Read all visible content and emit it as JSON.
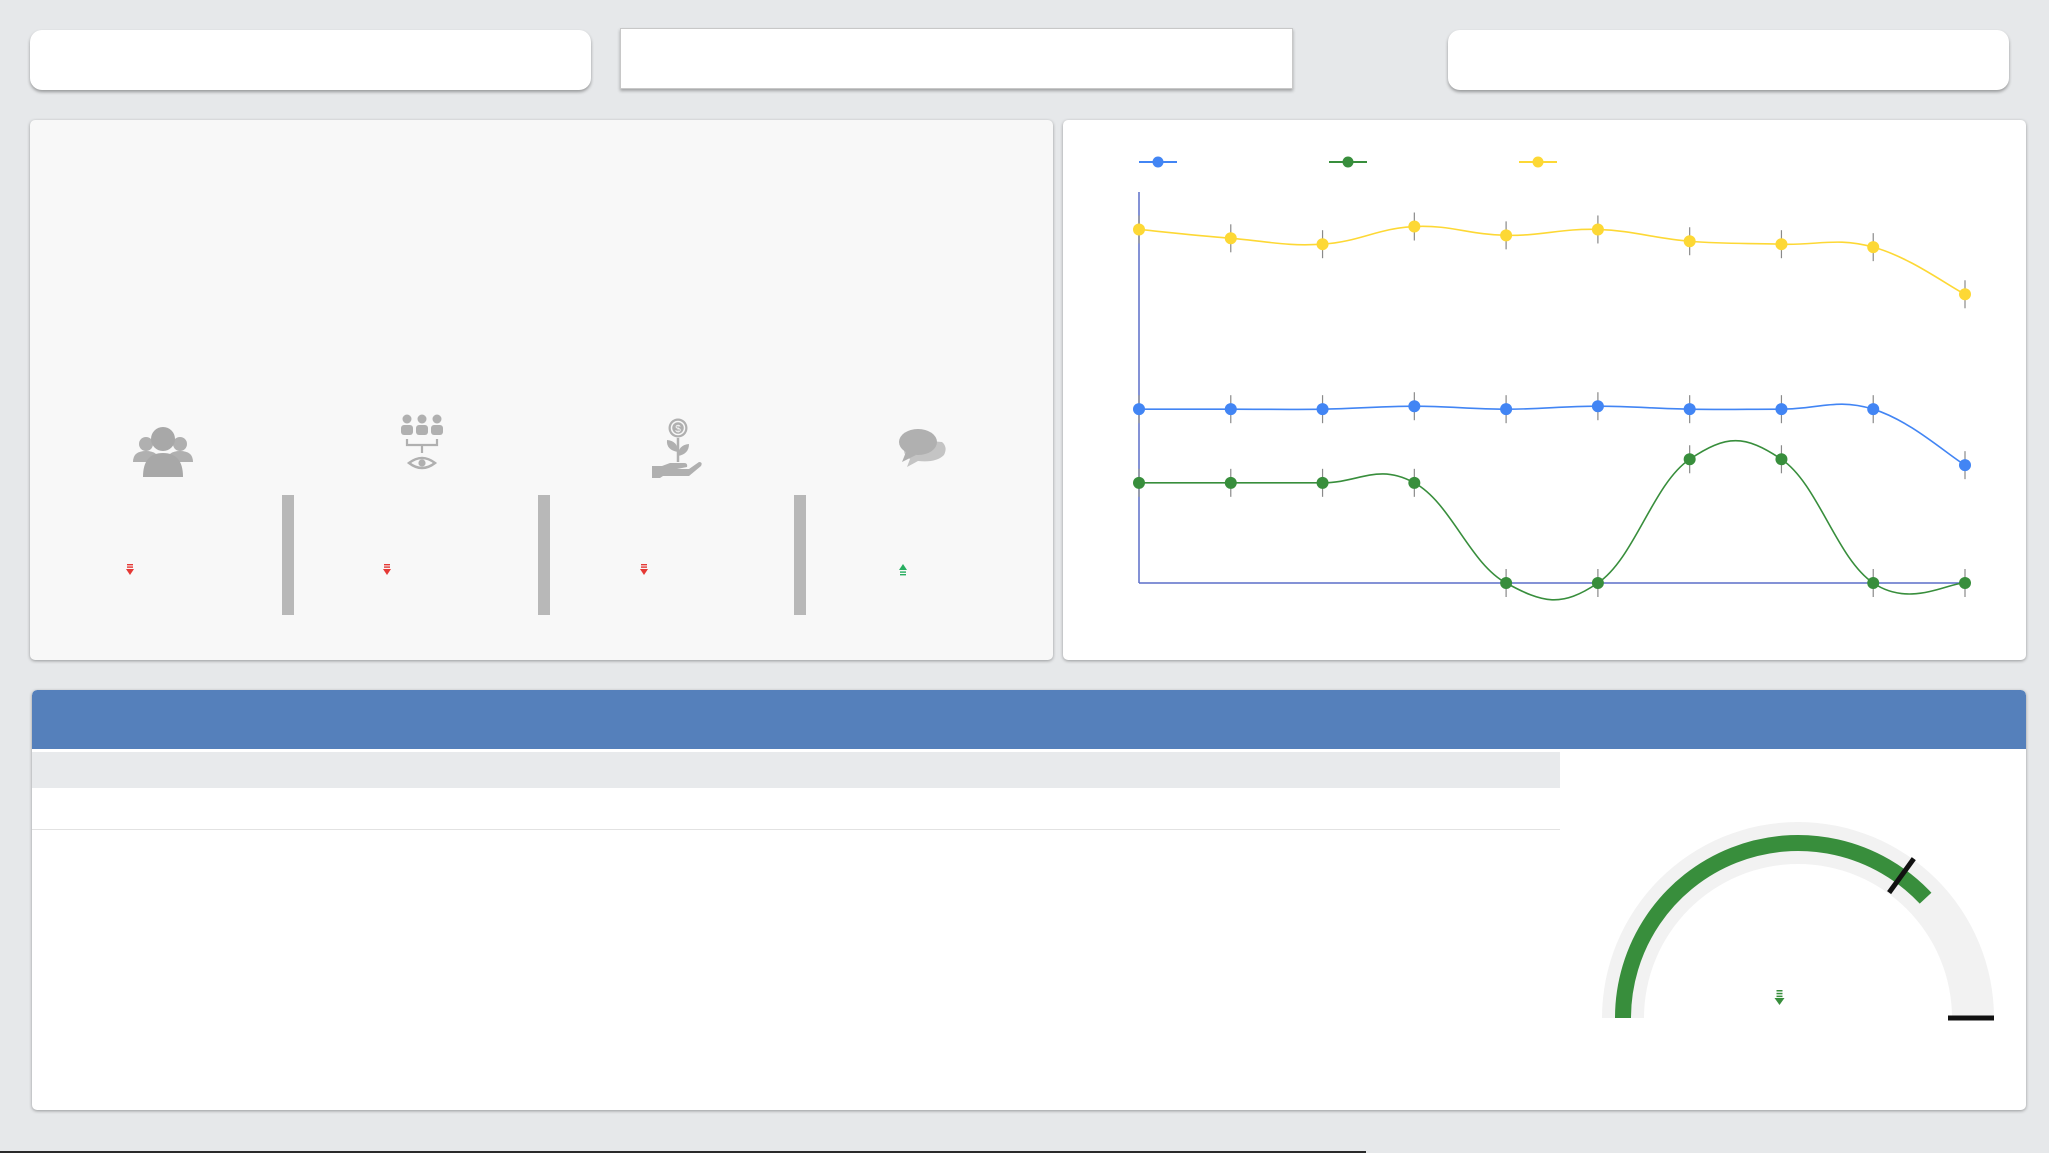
{
  "filters": {
    "left_filter": "",
    "search_value": "",
    "search_placeholder": "",
    "right_filter": ""
  },
  "kpis": [
    {
      "icon": "users-group-icon",
      "trend": "down",
      "trend_color": "#e53935"
    },
    {
      "icon": "team-vision-icon",
      "trend": "down",
      "trend_color": "#e53935"
    },
    {
      "icon": "money-plant-hand-icon",
      "trend": "down",
      "trend_color": "#e53935"
    },
    {
      "icon": "chat-bubbles-icon",
      "trend": "up",
      "trend_color": "#27ae60"
    }
  ],
  "chart_data": {
    "type": "line",
    "title": "",
    "legend": "top-left",
    "x": [
      1,
      2,
      3,
      4,
      5,
      6,
      7,
      8,
      9,
      10
    ],
    "series": [
      {
        "color": "#4285f4",
        "values": [
          59,
          59,
          59,
          60,
          59,
          60,
          59,
          59,
          59,
          40
        ]
      },
      {
        "color": "#388e3c",
        "values": [
          34,
          34,
          34,
          34,
          0,
          0,
          42,
          42,
          0,
          0
        ]
      },
      {
        "color": "#fdd835",
        "values": [
          120,
          117,
          115,
          121,
          118,
          120,
          116,
          115,
          114,
          98
        ]
      }
    ],
    "ylim": [
      0,
      130
    ]
  },
  "table": {
    "headers": [],
    "rows": []
  },
  "gauge": {
    "value_fraction": 0.76,
    "target_fraction": 0.7,
    "bar_color": "#388e3c",
    "track_color": "#f2f2f2",
    "trend": "down",
    "trend_color": "#388e3c"
  }
}
